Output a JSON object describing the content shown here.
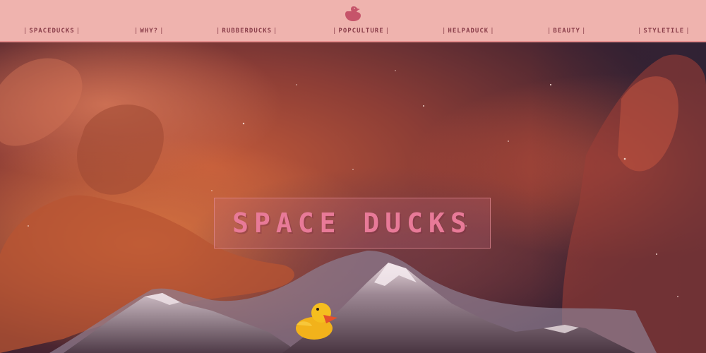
{
  "header": {
    "logo_icon": "duck-icon",
    "nav": [
      {
        "label": "SPACEDUCKS"
      },
      {
        "label": "WHY?"
      },
      {
        "label": "RUBBERDUCKS"
      },
      {
        "label": "POPCULTURE"
      },
      {
        "label": "HELPADUCK"
      },
      {
        "label": "BEAUTY"
      },
      {
        "label": "STYLETILE"
      }
    ]
  },
  "hero": {
    "title": "SPACE DUCKS"
  },
  "colors": {
    "nav_bg": "#efb3ae",
    "nav_text": "#8a3e4a",
    "title": "#e87a98"
  }
}
